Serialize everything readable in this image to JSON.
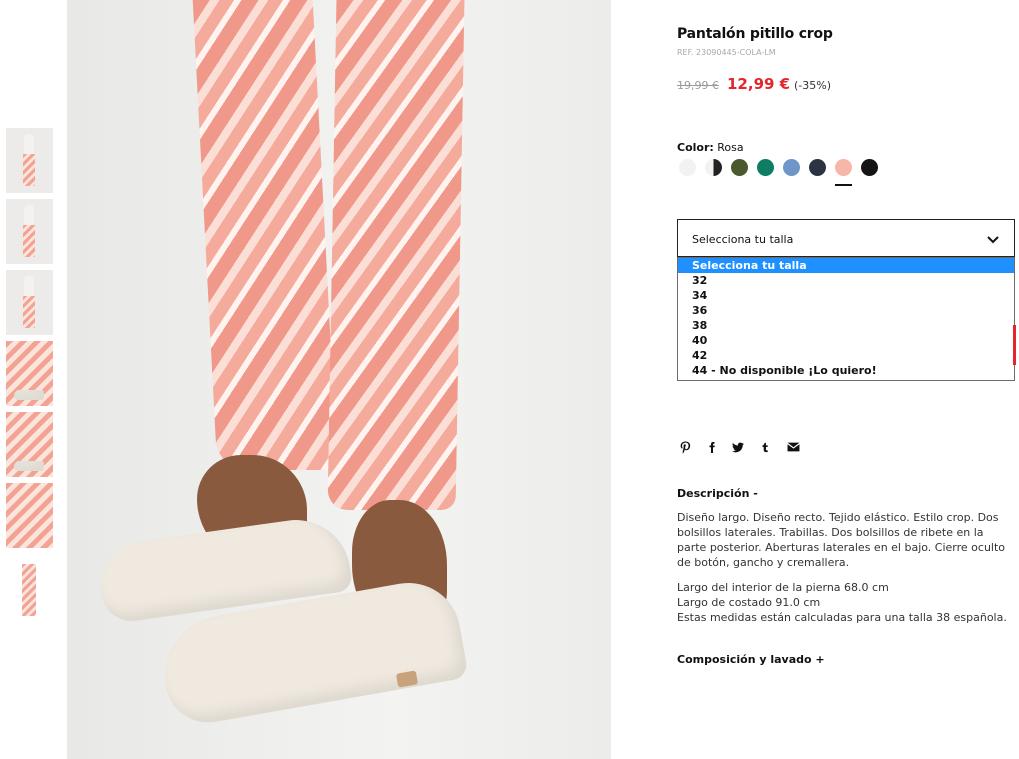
{
  "product": {
    "title": "Pantalón pitillo crop",
    "ref": "REF. 23090445-COLA-LM",
    "price_old": "19,99 €",
    "price_new": "12,99 €",
    "discount": "(-35%)"
  },
  "color": {
    "label": "Color:",
    "value": "Rosa",
    "swatches": [
      {
        "name": "white",
        "hex": "#f2f2f2"
      },
      {
        "name": "black-white",
        "hex": "#222222"
      },
      {
        "name": "khaki",
        "hex": "#4b5a2e"
      },
      {
        "name": "green",
        "hex": "#0e7e63"
      },
      {
        "name": "blue",
        "hex": "#6e96c8"
      },
      {
        "name": "navy",
        "hex": "#2c3444"
      },
      {
        "name": "pink",
        "hex": "#f6b6a8"
      },
      {
        "name": "black",
        "hex": "#151515"
      }
    ],
    "selected_index": 6
  },
  "size_select": {
    "placeholder": "Selecciona tu talla",
    "options": [
      "Selecciona tu talla",
      "32",
      "34",
      "36",
      "38",
      "40",
      "42",
      "44 - No disponible ¡Lo quiero!"
    ]
  },
  "share": {
    "icons": [
      "pinterest-icon",
      "facebook-icon",
      "twitter-icon",
      "tumblr-icon",
      "mail-icon"
    ]
  },
  "description": {
    "title": "Descripción -",
    "text": "Diseño largo. Diseño recto. Tejido elástico. Estilo crop. Dos bolsillos laterales. Trabillas. Dos bolsillos de ribete en la parte posterior. Aberturas laterales en el bajo. Cierre oculto de botón, gancho y cremallera.",
    "measure1": "Largo del interior de la pierna 68.0 cm",
    "measure2": "Largo de costado 91.0 cm",
    "measure3": "Estas medidas están calculadas para una talla 38 española."
  },
  "composition": {
    "title": "Composición y lavado +"
  },
  "colors": {
    "sale": "#e3262b",
    "selected_option": "#1e90ff"
  }
}
